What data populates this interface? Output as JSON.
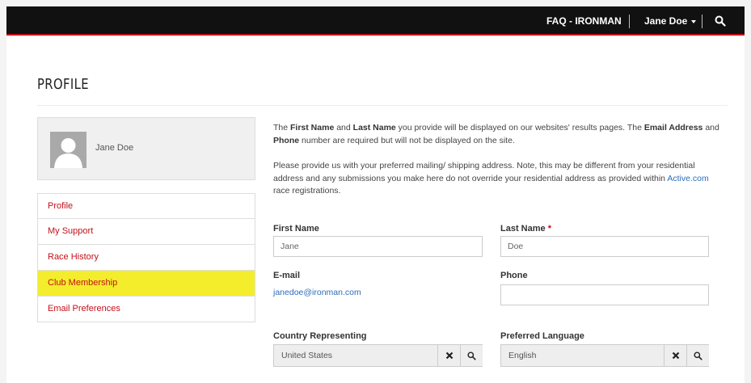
{
  "header": {
    "faq_link": "FAQ - IRONMAN",
    "user_menu": "Jane Doe",
    "search_icon": "search-icon"
  },
  "page_title": "PROFILE",
  "profile_card": {
    "name": "Jane Doe",
    "avatar_icon": "user-avatar-icon"
  },
  "sidebar": {
    "items": [
      {
        "label": "Profile"
      },
      {
        "label": "My Support"
      },
      {
        "label": "Race History"
      },
      {
        "label": "Club Membership",
        "active": true
      },
      {
        "label": "Email Preferences"
      }
    ]
  },
  "intro": {
    "p1_part1": "The ",
    "p1_bold1": "First Name",
    "p1_part2": " and ",
    "p1_bold2": "Last Name",
    "p1_part3": " you provide will be displayed on our websites' results pages. The ",
    "p1_bold3": "Email Address",
    "p1_part4": " and ",
    "p1_bold4": "Phone",
    "p1_part5": " number are required but will not be displayed on the site.",
    "p2_text": "Please provide us with your preferred mailing/ shipping address. Note, this may be different from your residential address and any submissions you make here do not override your residential address as provided within ",
    "p2_link": "Active.com",
    "p2_end": " race registrations."
  },
  "form": {
    "first_name": {
      "label": "First Name",
      "value": "Jane"
    },
    "last_name": {
      "label": "Last Name",
      "required_mark": "*",
      "value": "Doe"
    },
    "email": {
      "label": "E-mail",
      "value": "janedoe@ironman.com"
    },
    "phone": {
      "label": "Phone",
      "value": ""
    },
    "country": {
      "label": "Country Representing",
      "value": "United States"
    },
    "language": {
      "label": "Preferred Language",
      "value": "English"
    }
  },
  "colors": {
    "topbar": "#111111",
    "accent_red": "#c4101a",
    "active_highlight": "#f3ed2c",
    "link_blue": "#2a6ebb"
  }
}
